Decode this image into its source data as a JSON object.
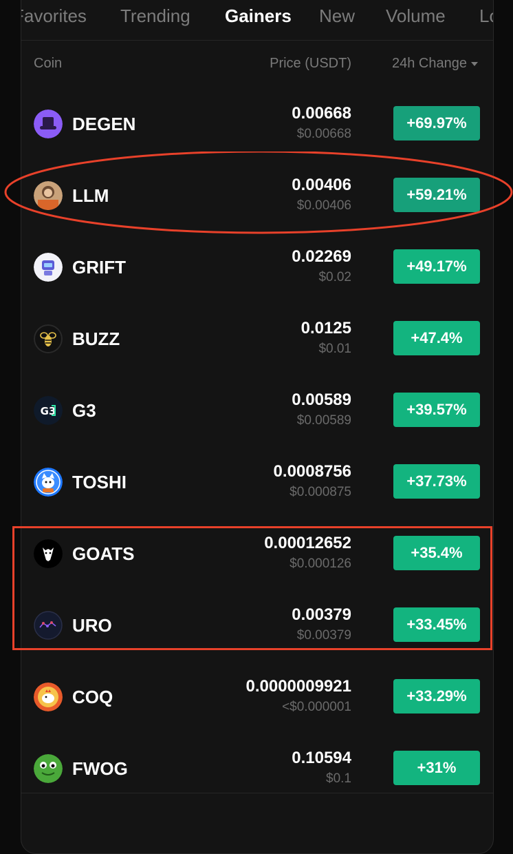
{
  "tabs": [
    "Favorites",
    "Trending",
    "Gainers",
    "New",
    "Volume",
    "Lo"
  ],
  "active_tab": "Gainers",
  "header": {
    "coin": "Coin",
    "price": "Price (USDT)",
    "change": "24h Change"
  },
  "rows": [
    {
      "symbol": "DEGEN",
      "price": "0.00668",
      "fiat": "$0.00668",
      "change": "+69.97%",
      "icon": "degen-hat-icon"
    },
    {
      "symbol": "LLM",
      "price": "0.00406",
      "fiat": "$0.00406",
      "change": "+59.21%",
      "icon": "llm-avatar-icon"
    },
    {
      "symbol": "GRIFT",
      "price": "0.02269",
      "fiat": "$0.02",
      "change": "+49.17%",
      "icon": "grift-robot-icon"
    },
    {
      "symbol": "BUZZ",
      "price": "0.0125",
      "fiat": "$0.01",
      "change": "+47.4%",
      "icon": "bee-icon"
    },
    {
      "symbol": "G3",
      "price": "0.00589",
      "fiat": "$0.00589",
      "change": "+39.57%",
      "icon": "g3-logo-icon"
    },
    {
      "symbol": "TOSHI",
      "price": "0.0008756",
      "fiat": "$0.000875",
      "change": "+37.73%",
      "icon": "toshi-cat-icon"
    },
    {
      "symbol": "GOATS",
      "price": "0.00012652",
      "fiat": "$0.000126",
      "change": "+35.4%",
      "icon": "goat-icon"
    },
    {
      "symbol": "URO",
      "price": "0.00379",
      "fiat": "$0.00379",
      "change": "+33.45%",
      "icon": "uro-molecule-icon"
    },
    {
      "symbol": "COQ",
      "price": "0.0000009921",
      "fiat": "<$0.000001",
      "change": "+33.29%",
      "icon": "chicken-icon"
    },
    {
      "symbol": "FWOG",
      "price": "0.10594",
      "fiat": "$0.1",
      "change": "+31%",
      "icon": "frog-icon"
    }
  ],
  "colors": {
    "background": "#141414",
    "gain": "#13b47f",
    "highlight": "#e8412a",
    "muted": "#6a6a6a"
  }
}
